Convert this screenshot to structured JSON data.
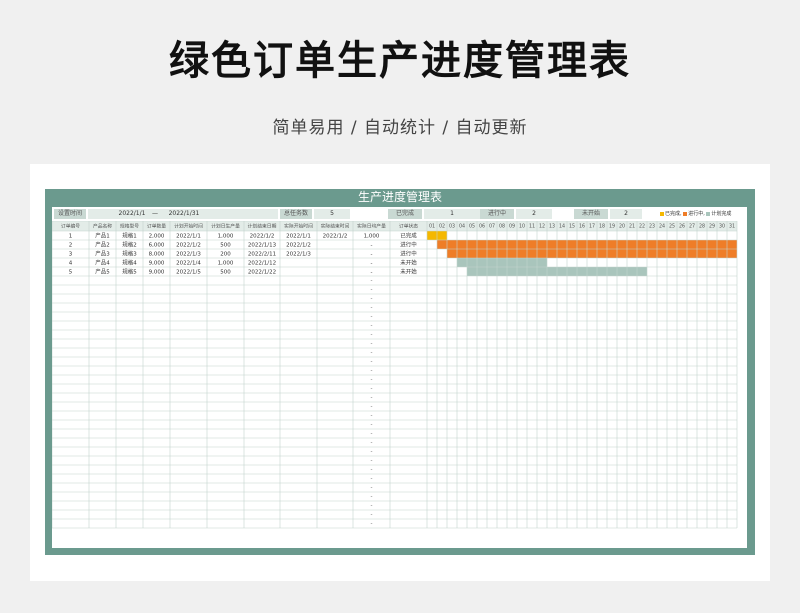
{
  "page": {
    "title": "绿色订单生产进度管理表",
    "subtitle": "简单易用 / 自动统计 / 自动更新"
  },
  "sheet": {
    "title": "生产进度管理表",
    "summary": {
      "period_label": "设置时间",
      "start_date": "2022/1/1",
      "dash": "—",
      "end_date": "2022/1/31",
      "total_label": "总任务数",
      "total_value": "5",
      "done_label": "已完成",
      "done_value": "1",
      "progress_label": "进行中",
      "progress_value": "2",
      "notstarted_label": "未开始",
      "notstarted_value": "2"
    },
    "legend": [
      "已完成,",
      "进行中,",
      "计划完成"
    ],
    "colors": {
      "frame": "#6b9a8e",
      "done": "#f5b800",
      "in_progress": "#ef7d27",
      "planned": "#a9c5bc",
      "header": "#e3ece8"
    },
    "columns": [
      "订单编号",
      "产品名称",
      "规格型号",
      "订单数量",
      "计划开始时间",
      "计划日生产量",
      "计划结束日期",
      "实际开始时间",
      "实际结束时间",
      "实际日均产量",
      "订单状态"
    ],
    "days": [
      "01",
      "02",
      "03",
      "04",
      "05",
      "06",
      "07",
      "08",
      "09",
      "10",
      "11",
      "12",
      "13",
      "14",
      "15",
      "16",
      "17",
      "18",
      "19",
      "20",
      "21",
      "22",
      "23",
      "24",
      "25",
      "26",
      "27",
      "28",
      "29",
      "30",
      "31"
    ],
    "rows": [
      {
        "cells": [
          "1",
          "产品1",
          "规格1",
          "2,000",
          "2022/1/1",
          "1,000",
          "2022/1/2",
          "2022/1/1",
          "2022/1/2",
          "1,000",
          "已完成"
        ],
        "bars": [
          {
            "type": "done",
            "start": 1,
            "end": 2
          }
        ]
      },
      {
        "cells": [
          "2",
          "产品2",
          "规格2",
          "6,000",
          "2022/1/2",
          "500",
          "2022/1/13",
          "2022/1/2",
          "",
          "-",
          "进行中"
        ],
        "bars": [
          {
            "type": "in_progress",
            "start": 2,
            "end": 31
          }
        ]
      },
      {
        "cells": [
          "3",
          "产品3",
          "规格3",
          "8,000",
          "2022/1/3",
          "200",
          "2022/2/11",
          "2022/1/3",
          "",
          "-",
          "进行中"
        ],
        "bars": [
          {
            "type": "in_progress",
            "start": 3,
            "end": 31
          }
        ]
      },
      {
        "cells": [
          "4",
          "产品4",
          "规格4",
          "9,000",
          "2022/1/4",
          "1,000",
          "2022/1/12",
          "",
          "",
          "-",
          "未开始"
        ],
        "bars": [
          {
            "type": "planned",
            "start": 4,
            "end": 12
          }
        ]
      },
      {
        "cells": [
          "5",
          "产品5",
          "规格5",
          "9,000",
          "2022/1/5",
          "500",
          "2022/1/22",
          "",
          "",
          "-",
          "未开始"
        ],
        "bars": [
          {
            "type": "planned",
            "start": 5,
            "end": 22
          }
        ]
      }
    ],
    "empty_row_marker": "-",
    "empty_row_count": 28
  }
}
